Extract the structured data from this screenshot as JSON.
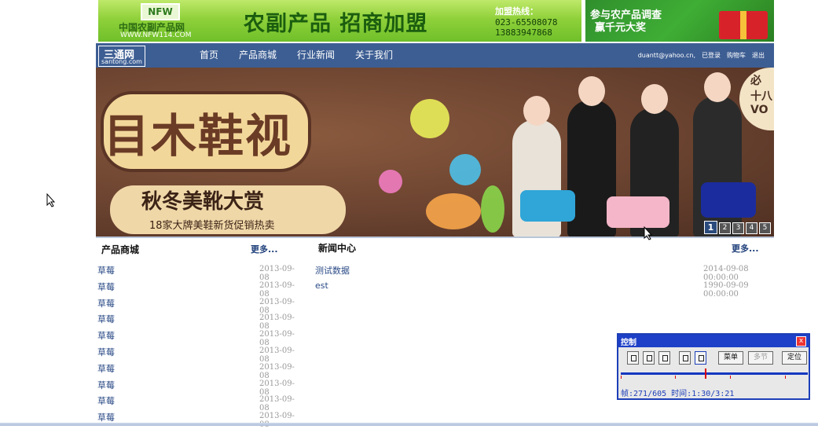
{
  "banner_left": {
    "logo_mark": "NFW",
    "logo_name": "中国农副产品网",
    "logo_url": "WWW.NFW114.COM",
    "headline": "农副产品 招商加盟",
    "hotline_label": "加盟热线：",
    "hotline_1": "023-65508078",
    "hotline_2": "13883947868"
  },
  "banner_right": {
    "line1": "参与农产品调查",
    "line2": "赢千元大奖"
  },
  "nav": {
    "brand": "三通网",
    "brand_sub": "santong.com",
    "menu": [
      "首页",
      "产品商城",
      "行业新闻",
      "关于我们"
    ],
    "user_email": "duantt@yahoo.cn,",
    "logged_in": "已登录",
    "cart": "购物车",
    "logout": "退出"
  },
  "hero": {
    "title": "目木鞋视",
    "subtitle": "秋冬美靴大赏",
    "subtitle2": "18家大牌美鞋新货促销热卖",
    "corner": "必 十八 VO",
    "pages": [
      "1",
      "2",
      "3",
      "4",
      "5"
    ],
    "active_page": "1"
  },
  "products": {
    "heading": "产品商城",
    "more": "更多...",
    "items": [
      {
        "name": "草莓",
        "date": "2013-09-08"
      },
      {
        "name": "草莓",
        "date": "2013-09-08"
      },
      {
        "name": "草莓",
        "date": "2013-09-08"
      },
      {
        "name": "草莓",
        "date": "2013-09-08"
      },
      {
        "name": "草莓",
        "date": "2013-09-08"
      },
      {
        "name": "草莓",
        "date": "2013-09-08"
      },
      {
        "name": "草莓",
        "date": "2013-09-08"
      },
      {
        "name": "草莓",
        "date": "2013-09-08"
      },
      {
        "name": "草莓",
        "date": "2013-09-08"
      },
      {
        "name": "草莓",
        "date": "2013-09-08"
      }
    ]
  },
  "news": {
    "heading": "新闻中心",
    "more": "更多...",
    "items": [
      {
        "title": "测试数据",
        "date": "2014-09-08 00:00:00"
      },
      {
        "title": "est",
        "date": "1990-09-09 00:00:00"
      }
    ]
  },
  "control": {
    "title": "控制",
    "close": "x",
    "menu": "菜单",
    "multi": "多节",
    "locate": "定位",
    "status": "帧:271/605 时间:1:30/3:21",
    "progress": 0.448
  },
  "colors": {
    "nav_bg": "#3d5e93",
    "link": "#2a4a86",
    "panel_border": "#1d3fb8"
  }
}
